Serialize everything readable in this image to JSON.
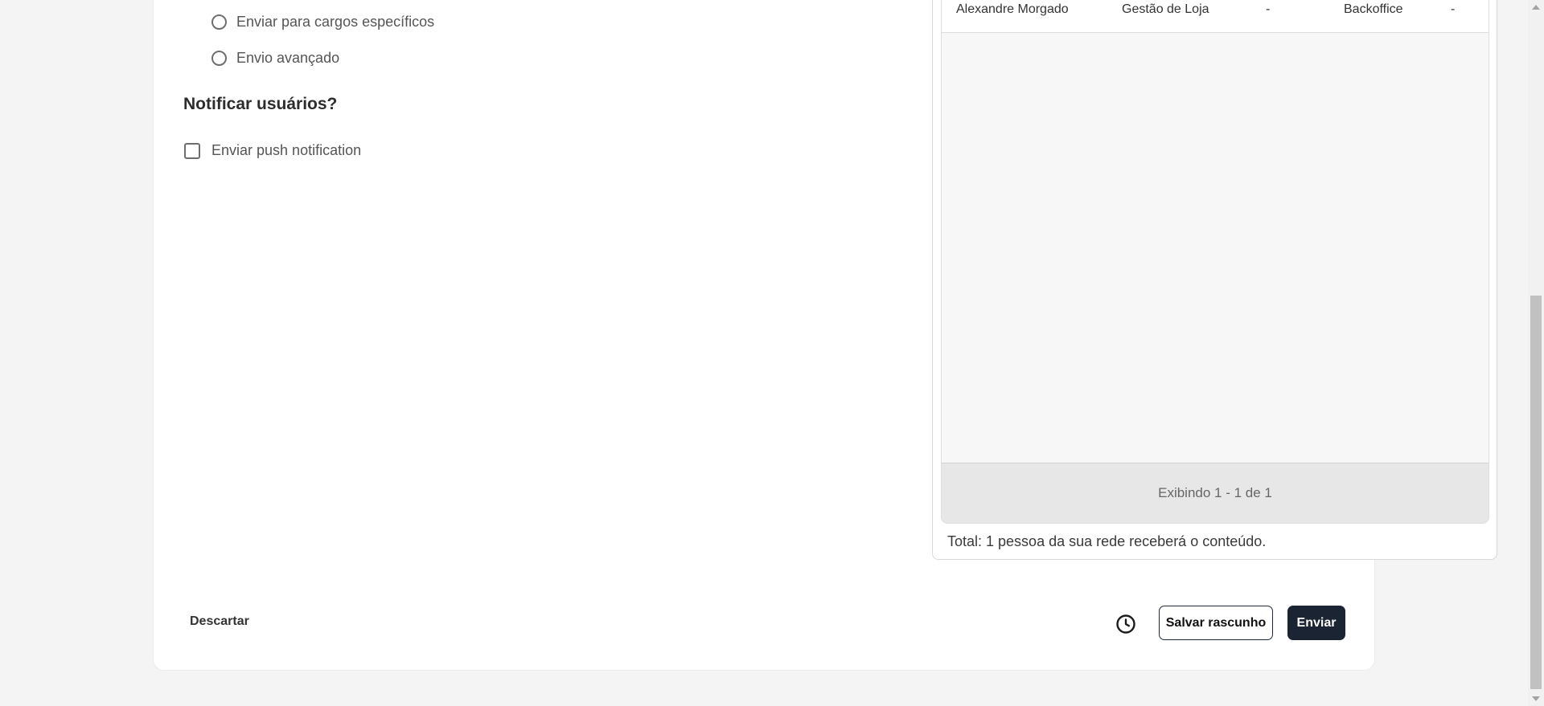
{
  "audience_options": [
    {
      "label": "Enviar para cargos específicos",
      "selected": false
    },
    {
      "label": "Envio avançado",
      "selected": false
    }
  ],
  "notify": {
    "title": "Notificar usuários?",
    "push_label": "Enviar push notification",
    "push_checked": false
  },
  "table": {
    "rows": [
      [
        "Alexandre Morgado",
        "Gestão de Loja",
        "-",
        "Backoffice",
        "-"
      ]
    ],
    "footer": "Exibindo 1 - 1 de 1"
  },
  "total_text": "Total: 1 pessoa da sua rede receberá o conteúdo.",
  "actions": {
    "discard": "Descartar",
    "schedule_icon": "clock-icon",
    "save_draft": "Salvar rascunho",
    "send": "Enviar"
  },
  "colors": {
    "primary": "#1b2433",
    "background": "#f4f4f4"
  }
}
